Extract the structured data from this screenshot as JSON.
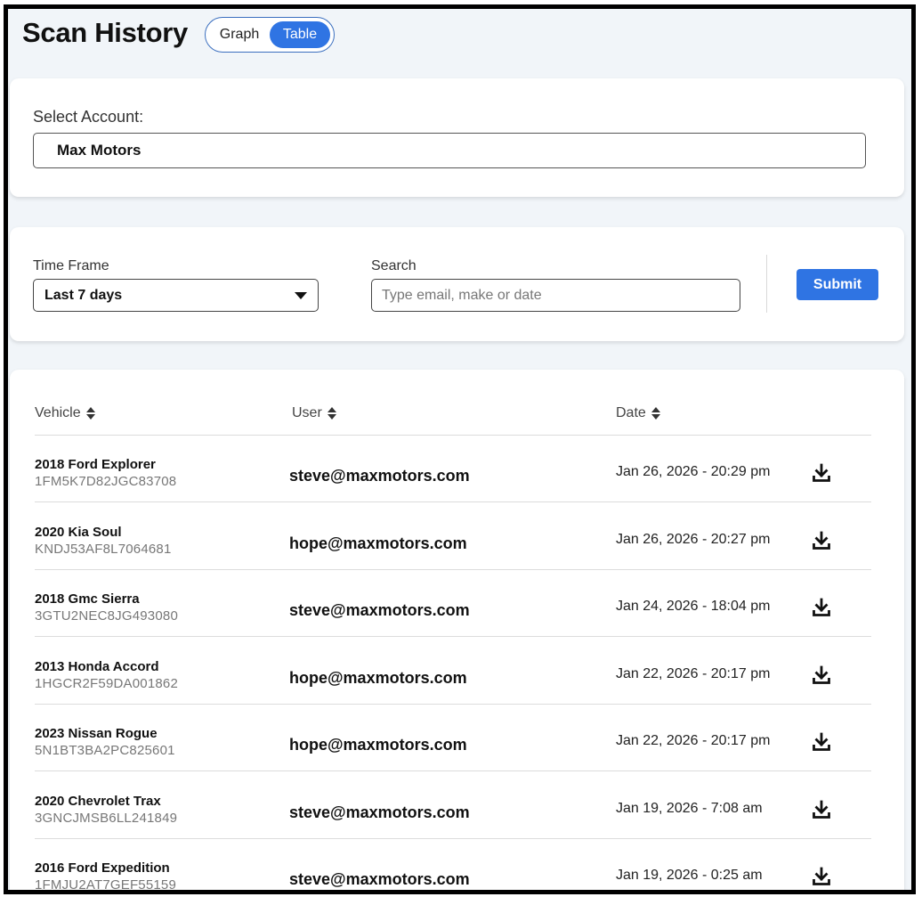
{
  "header": {
    "title": "Scan History",
    "view_toggle": [
      {
        "label": "Graph",
        "active": false
      },
      {
        "label": "Table",
        "active": true
      }
    ]
  },
  "account": {
    "label": "Select Account:",
    "value": "Max Motors"
  },
  "filters": {
    "time_frame_label": "Time Frame",
    "time_frame_value": "Last 7 days",
    "search_label": "Search",
    "search_placeholder": "Type email, make or date",
    "search_value": "",
    "submit_label": "Submit"
  },
  "table": {
    "columns": [
      "Vehicle",
      "User",
      "Date"
    ],
    "rows": [
      {
        "vehicle": "2018 Ford Explorer",
        "vin": "1FM5K7D82JGC83708",
        "user": "steve@maxmotors.com",
        "date": "Jan 26, 2026 - 20:29 pm"
      },
      {
        "vehicle": "2020 Kia Soul",
        "vin": "KNDJ53AF8L7064681",
        "user": "hope@maxmotors.com",
        "date": "Jan 26, 2026 - 20:27 pm"
      },
      {
        "vehicle": "2018 Gmc Sierra",
        "vin": "3GTU2NEC8JG493080",
        "user": "steve@maxmotors.com",
        "date": "Jan 24, 2026 - 18:04 pm"
      },
      {
        "vehicle": "2013 Honda Accord",
        "vin": "1HGCR2F59DA001862",
        "user": "hope@maxmotors.com",
        "date": "Jan 22, 2026 - 20:17 pm"
      },
      {
        "vehicle": "2023 Nissan Rogue",
        "vin": "5N1BT3BA2PC825601",
        "user": "hope@maxmotors.com",
        "date": "Jan 22, 2026 - 20:17 pm"
      },
      {
        "vehicle": "2020 Chevrolet Trax",
        "vin": "3GNCJMSB6LL241849",
        "user": "steve@maxmotors.com",
        "date": "Jan 19, 2026 - 7:08 am"
      },
      {
        "vehicle": "2016 Ford Expedition",
        "vin": "1FMJU2AT7GEF55159",
        "user": "steve@maxmotors.com",
        "date": "Jan 19, 2026 - 0:25 am"
      }
    ]
  },
  "icons": {
    "download": "download-icon",
    "sort": "sort-icon",
    "dropdown": "chevron-down-icon"
  },
  "colors": {
    "accent": "#2f74e3",
    "page_background": "#f1f5f9"
  }
}
